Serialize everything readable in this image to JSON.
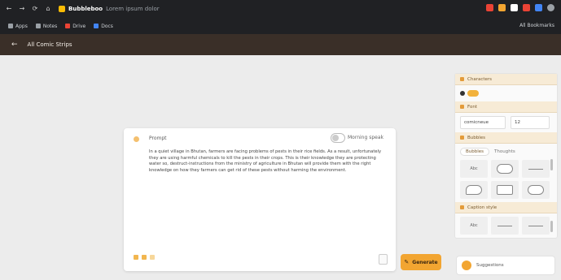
{
  "browser": {
    "tab_title_bold": "Bubbleboo",
    "tab_title_rest": "Lorem ipsum dolor",
    "bookmarks": [
      "Apps",
      "Notes",
      "Drive",
      "Docs"
    ],
    "bookmarks_right": "All Bookmarks",
    "extension_colors": [
      "#ea4335",
      "#f2a531",
      "#ffffff",
      "#ea4335",
      "#4285f4",
      "#9aa0a6"
    ]
  },
  "app": {
    "back_icon": "arrow-left-icon",
    "header_title": "All Comic Strips"
  },
  "editor": {
    "label": "Prompt",
    "toggle_label": "Morning speak",
    "text": "In a quiet village in Bhutan, farmers are facing problems of pests in their rice fields. As a result, unfortunately they are using harmful chemicals to kill the pests in their crops. This is their knowledge they are protecting water so, destruct-instructions from the ministry of agriculture in Bhutan will provide them with the right knowledge on how they farmers can get rid of these pests without harming the environment.",
    "generate_label": "Generate"
  },
  "panel": {
    "characters": "Characters",
    "font": "Font",
    "font_name": "comicneue",
    "font_size": "12",
    "bubbles": "Bubbles",
    "bubbles_tab_active": "Bubbles",
    "bubbles_tab_other": "Thoughts",
    "bubble_cells": [
      "Abc",
      "",
      "",
      "",
      "",
      "",
      "",
      "",
      ""
    ],
    "captionstyle": "Caption style",
    "caption_cells": [
      "Abc",
      "",
      ""
    ],
    "assistant": "Suggestions"
  },
  "colors": {
    "accent": "#f2a531",
    "header_bg": "#3a2f28"
  }
}
